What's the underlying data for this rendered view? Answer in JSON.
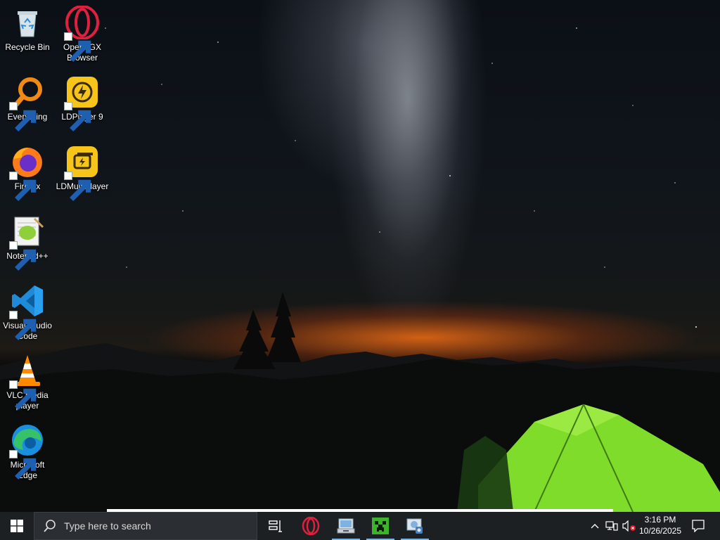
{
  "desktop_icons": [
    {
      "label": "Recycle Bin",
      "icon": "recycle-bin-icon"
    },
    {
      "label": "Opera GX Browser",
      "icon": "opera-gx-icon"
    },
    {
      "label": "Everything",
      "icon": "everything-search-icon"
    },
    {
      "label": "LDPlayer 9",
      "icon": "ldplayer-icon"
    },
    {
      "label": "Firefox",
      "icon": "firefox-icon"
    },
    {
      "label": "LDMultiPlayer",
      "icon": "ldmultiplayer-icon"
    },
    {
      "label": "Notepad++",
      "icon": "notepad-plus-plus-icon"
    },
    {
      "label": "Visual Studio Code",
      "icon": "vscode-icon"
    },
    {
      "label": "VLC media player",
      "icon": "vlc-icon"
    },
    {
      "label": "Microsoft Edge",
      "icon": "edge-icon"
    }
  ],
  "taskbar": {
    "search_placeholder": "Type here to search",
    "pinned_apps": [
      {
        "name": "task-view",
        "icon": "task-view-icon"
      },
      {
        "name": "opera-gx",
        "icon": "opera-gx-icon"
      },
      {
        "name": "file-manager",
        "icon": "file-manager-icon",
        "running": true
      },
      {
        "name": "minecraft",
        "icon": "minecraft-creeper-icon",
        "running": true
      },
      {
        "name": "control-panel",
        "icon": "control-panel-icon",
        "running": true
      }
    ],
    "tray": {
      "chevron": "chevron-up-icon",
      "network": "network-icon",
      "volume": "volume-muted-icon",
      "time": "3:16 PM",
      "date": "10/26/2025",
      "notifications": "notification-icon"
    }
  },
  "colors": {
    "taskbar_bg": "#1d2023",
    "search_bg": "#2b2e33",
    "running_indicator": "#77b7e6",
    "tent_green": "#7fdc2a",
    "horizon_glow": "#f06e14"
  }
}
